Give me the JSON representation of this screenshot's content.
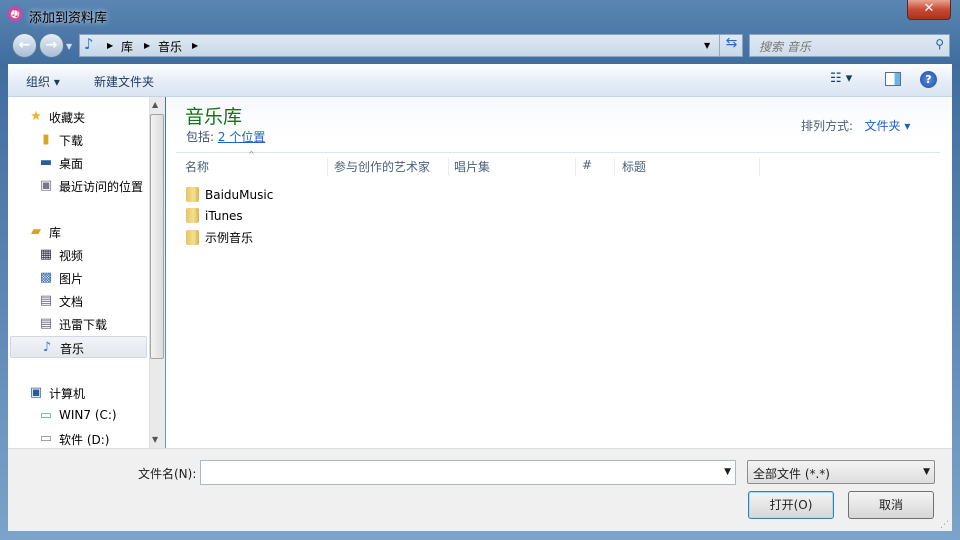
{
  "window": {
    "title": "添加到资料库",
    "close": "✕"
  },
  "address": {
    "segments": [
      "库",
      "音乐"
    ]
  },
  "search": {
    "placeholder": "搜索 音乐"
  },
  "toolbar": {
    "organize": "组织",
    "new_folder": "新建文件夹"
  },
  "sidebar": {
    "favorites": "收藏夹",
    "fav_items": [
      "下载",
      "桌面",
      "最近访问的位置"
    ],
    "libraries": "库",
    "lib_items": [
      "视频",
      "图片",
      "文档",
      "迅雷下载",
      "音乐"
    ],
    "computer": "计算机",
    "drives": [
      "WIN7 (C:)",
      "软件 (D:)"
    ],
    "selected": "音乐"
  },
  "main": {
    "title": "音乐库",
    "includes_label": "包括:",
    "includes_link": "2 个位置",
    "sort_label": "排列方式:",
    "sort_value": "文件夹",
    "columns": [
      "名称",
      "参与创作的艺术家",
      "唱片集",
      "#",
      "标题"
    ],
    "files": [
      "BaiduMusic",
      "iTunes",
      "示例音乐"
    ]
  },
  "bottom": {
    "filename_label": "文件名(N):",
    "filename_value": "",
    "filter": "全部文件 (*.*)",
    "open": "打开(O)",
    "cancel": "取消"
  }
}
